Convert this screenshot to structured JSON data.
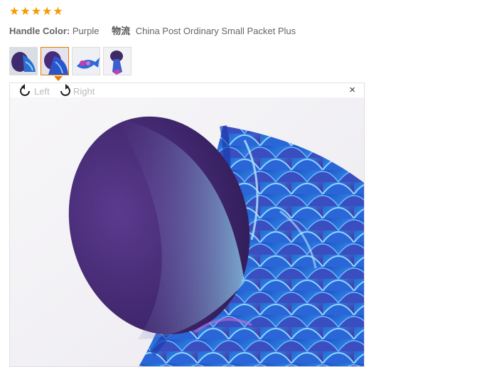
{
  "rating": {
    "stars": 5,
    "star_glyph": "★",
    "color": "#f59a00"
  },
  "meta": {
    "handle_label": "Handle Color:",
    "handle_value": "Purple",
    "logistics_label": "物流",
    "logistics_value": "China Post Ordinary Small Packet Plus"
  },
  "thumbnails": [
    {
      "name": "thumbnail-1",
      "active": false
    },
    {
      "name": "thumbnail-2",
      "active": true
    },
    {
      "name": "thumbnail-3",
      "active": false
    },
    {
      "name": "thumbnail-4",
      "active": false
    }
  ],
  "viewer": {
    "rotate_left_label": "Left",
    "rotate_right_label": "Right",
    "close_glyph": "×",
    "icons": [
      "rotate-left-icon",
      "rotate-right-icon",
      "close-icon"
    ]
  },
  "colors": {
    "accent": "#e87b00",
    "bristle": "#4a2a7a",
    "handle": "#2c55c9"
  }
}
